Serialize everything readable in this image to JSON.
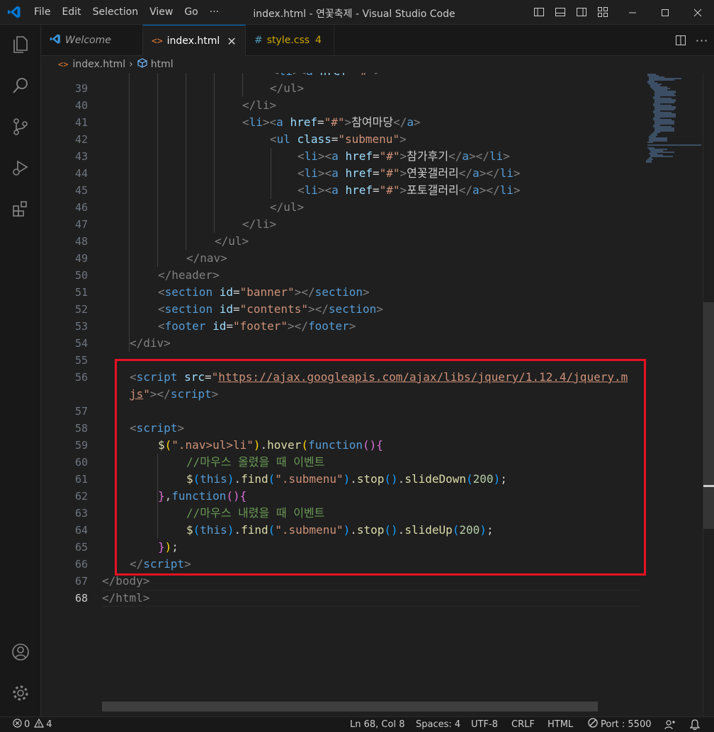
{
  "window": {
    "title": "index.html - 연꽃축제 - Visual Studio Code",
    "menu": [
      "File",
      "Edit",
      "Selection",
      "View",
      "Go",
      "···"
    ]
  },
  "tabs": [
    {
      "label": "Welcome",
      "icon": "vscode-icon"
    },
    {
      "label": "index.html",
      "icon": "html-icon",
      "active": true
    },
    {
      "label": "style.css",
      "icon": "css-icon",
      "badge": "4"
    }
  ],
  "breadcrumb": [
    "index.html",
    "html"
  ],
  "editor": {
    "line_numbers": [
      "39",
      "40",
      "41",
      "42",
      "43",
      "44",
      "45",
      "46",
      "47",
      "48",
      "49",
      "50",
      "51",
      "52",
      "53",
      "54",
      "55",
      "56",
      "",
      "57",
      "58",
      "59",
      "60",
      "61",
      "62",
      "63",
      "64",
      "65",
      "66",
      "67",
      "68"
    ],
    "current_line": "68",
    "code": {
      "l39": "</ul>",
      "l40": "</li>",
      "l41_a": "<li><a href=\"#\">",
      "l41_t": "참여마당",
      "l41_c": "</a>",
      "l42": "<ul class=\"submenu\">",
      "l43_t": "참가후기",
      "l44_t": "연꽃갤러리",
      "l45_t": "포토갤러리",
      "l46": "</ul>",
      "l47": "</li>",
      "l48": "</ul>",
      "l49": "</nav>",
      "l50": "</header>",
      "l51_id": "\"banner\"",
      "l52_id": "\"contents\"",
      "l53_id": "\"footer\"",
      "l54": "</div>",
      "l56_url": "https://ajax.googleapis.com/ajax/libs/jquery/1.12.4/jquery.m",
      "l56_url2": "js",
      "l59_sel": "\".nav>ul>li\"",
      "l60_cmt": "//마우스 올렸을 때 이벤트",
      "l61_sel": "\".submenu\"",
      "l61_num": "200",
      "l63_cmt": "//마우스 내렸을 때 이벤트",
      "l64_num": "200",
      "l67": "</body>",
      "l68": "</html>"
    }
  },
  "statusbar": {
    "errors": "0",
    "warnings": "4",
    "position": "Ln 68, Col 8",
    "spaces": "Spaces: 4",
    "encoding": "UTF-8",
    "eol": "CRLF",
    "language": "HTML",
    "port": "Port : 5500"
  },
  "colors": {
    "accent": "#0078d4",
    "highlight_box": "#e81123"
  }
}
